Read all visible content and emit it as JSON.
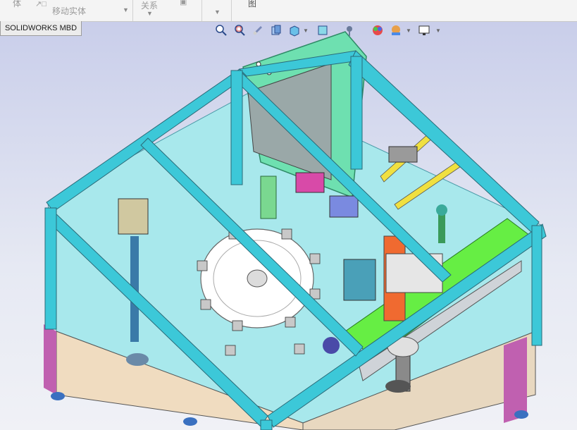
{
  "ribbon": {
    "solid_label": "体",
    "move_body_label": "移动实体",
    "relations_label": "关系",
    "drawing_label": "图"
  },
  "tab": {
    "label": "SOLIDWORKS MBD"
  },
  "heads_up_toolbar": {
    "icons": [
      "zoom-to-fit-icon",
      "zoom-to-area-icon",
      "previous-view-icon",
      "section-view-icon",
      "view-orientation-icon",
      "display-style-icon",
      "hide-show-items-icon",
      "edit-appearance-icon",
      "apply-scene-icon",
      "view-settings-icon"
    ]
  },
  "colors": {
    "frame": "#3cc8d8",
    "table": "#a8e8ec",
    "plate": "#ffffff",
    "guard": "#6ee0b0",
    "conveyor": "#66ee44",
    "legs": "#c060b0",
    "cabinet": "#f0dcc0",
    "background_top": "#c9ceea",
    "background_bottom": "#f0f1f6"
  }
}
